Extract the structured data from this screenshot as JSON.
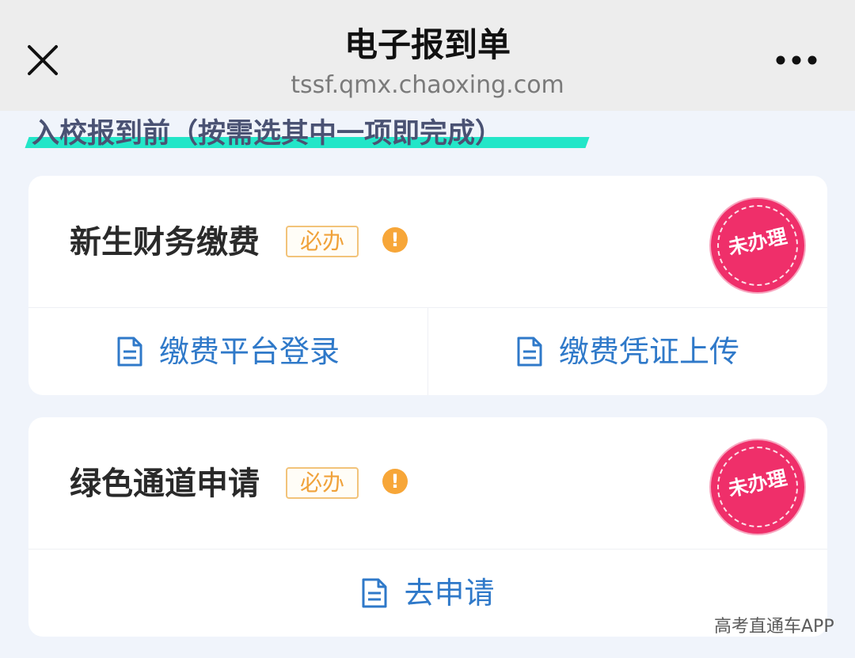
{
  "browser": {
    "title": "电子报到单",
    "url": "tssf.qmx.chaoxing.com",
    "close_icon": "close-icon",
    "more_icon": "more-icon"
  },
  "section": {
    "heading": "入校报到前（按需选其中一项即完成）",
    "highlight_color": "#23e6c8"
  },
  "cards": [
    {
      "title": "新生财务缴费",
      "badge": "必办",
      "warning_icon": "warning-icon",
      "stamp": "未办理",
      "actions": [
        {
          "label": "缴费平台登录",
          "icon": "document-icon"
        },
        {
          "label": "缴费凭证上传",
          "icon": "document-icon"
        }
      ]
    },
    {
      "title": "绿色通道申请",
      "badge": "必办",
      "warning_icon": "warning-icon",
      "stamp": "未办理",
      "actions": [
        {
          "label": "去申请",
          "icon": "document-icon"
        }
      ]
    }
  ],
  "watermark": "高考直通车APP",
  "colors": {
    "link": "#2f79c9",
    "badge": "#f0a23a",
    "warning": "#f7a638",
    "stamp": "#ef2f6a",
    "background": "#f0f4fb"
  }
}
